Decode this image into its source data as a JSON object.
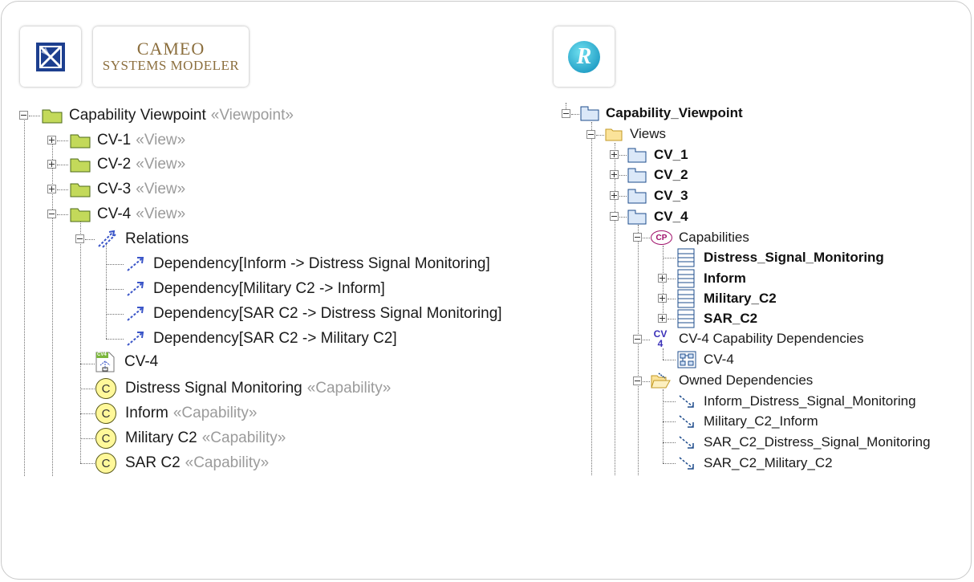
{
  "logos": {
    "cameo_line1": "CAMEO",
    "cameo_line2": "SYSTEMS MODELER",
    "rhapsody_letter": "R"
  },
  "left_tree": {
    "root": {
      "label": "Capability Viewpoint",
      "stereotype": "«Viewpoint»"
    },
    "views": [
      {
        "label": "CV-1",
        "stereotype": "«View»"
      },
      {
        "label": "CV-2",
        "stereotype": "«View»"
      },
      {
        "label": "CV-3",
        "stereotype": "«View»"
      },
      {
        "label": "CV-4",
        "stereotype": "«View»"
      }
    ],
    "relations_label": "Relations",
    "dependencies": [
      "Dependency[Inform -> Distress Signal Monitoring]",
      "Dependency[Military C2 -> Inform]",
      "Dependency[SAR C2 -> Distress Signal Monitoring]",
      "Dependency[SAR C2 -> Military C2]"
    ],
    "diagram_label": "CV-4",
    "diagram_icon_text": "CV4",
    "capabilities": [
      {
        "label": "Distress Signal Monitoring",
        "stereotype": "«Capability»"
      },
      {
        "label": "Inform",
        "stereotype": "«Capability»"
      },
      {
        "label": "Military C2",
        "stereotype": "«Capability»"
      },
      {
        "label": "SAR C2",
        "stereotype": "«Capability»"
      }
    ],
    "capability_icon_letter": "C"
  },
  "right_tree": {
    "root": "Capability_Viewpoint",
    "views_folder": "Views",
    "views": [
      "CV_1",
      "CV_2",
      "CV_3",
      "CV_4"
    ],
    "capabilities_label": "Capabilities",
    "capabilities_icon_text": "CP",
    "capability_items": [
      "Distress_Signal_Monitoring",
      "Inform",
      "Military_C2",
      "SAR_C2"
    ],
    "diagram_label": "CV-4 Capability Dependencies",
    "diagram_icon_text_1": "CV",
    "diagram_icon_text_2": "4",
    "diagram_child": "CV-4",
    "owned_label": "Owned Dependencies",
    "dependencies": [
      "Inform_Distress_Signal_Monitoring",
      "Military_C2_Inform",
      "SAR_C2_Distress_Signal_Monitoring",
      "SAR_C2_Military_C2"
    ]
  },
  "colors": {
    "folder_green": "#c3d95a",
    "capability_yellow": "#fff89a",
    "dependency_blue": "#3a55c8",
    "rhapsody_folder": "#dbe8f8",
    "rhapsody_capabilities": "#a0116b",
    "stereotype_gray": "#9b9b9b"
  }
}
